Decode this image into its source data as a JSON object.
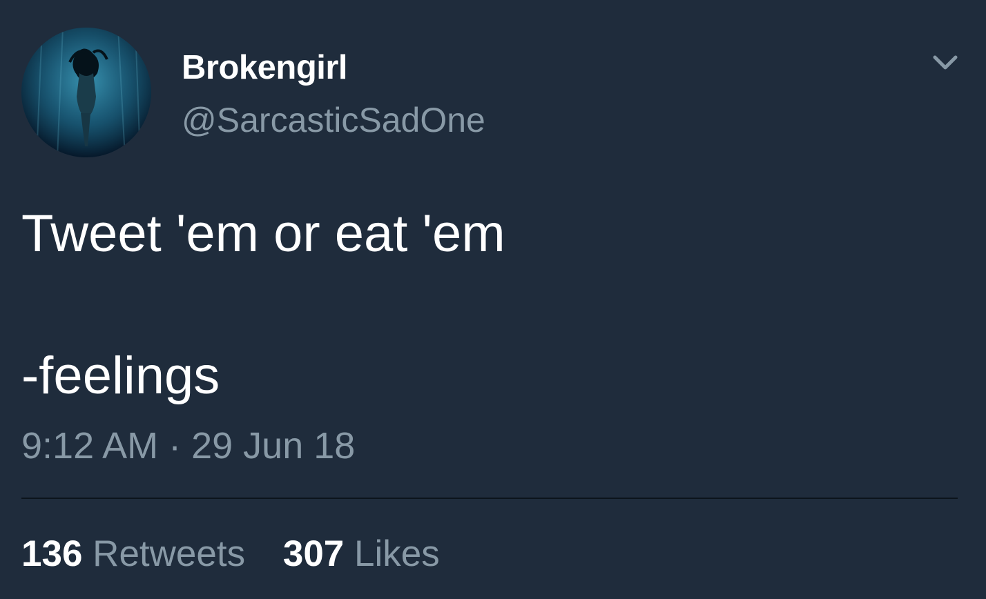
{
  "tweet": {
    "display_name": "Brokengirl",
    "handle": "@SarcasticSadOne",
    "text": "Tweet 'em or eat 'em\n\n-feelings",
    "timestamp": "9:12 AM · 29 Jun 18",
    "retweets": {
      "count": "136",
      "label": "Retweets"
    },
    "likes": {
      "count": "307",
      "label": "Likes"
    }
  },
  "icons": {
    "menu": "chevron-down-icon",
    "avatar": "avatar"
  },
  "colors": {
    "background": "#1f2c3c",
    "primary_text": "#ffffff",
    "secondary_text": "#8899a6",
    "divider": "#0c141c"
  }
}
